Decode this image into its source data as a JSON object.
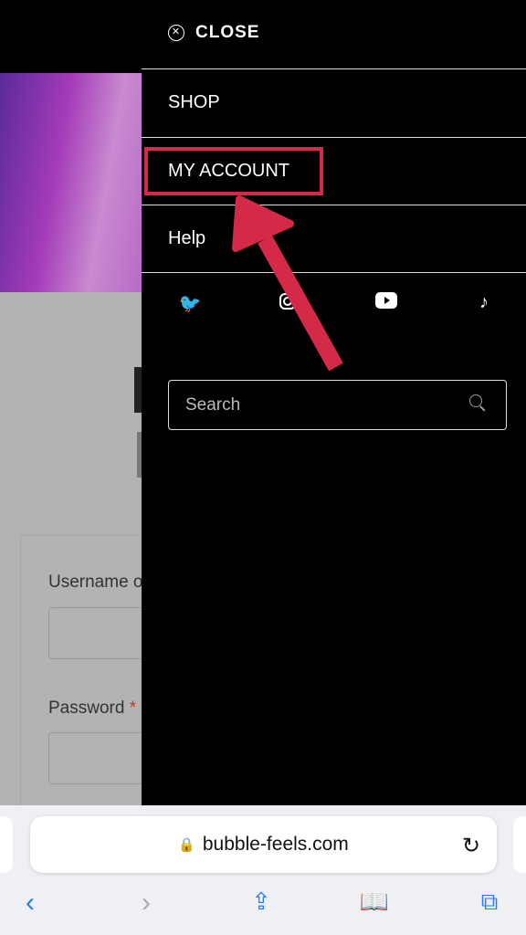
{
  "menu": {
    "close_label": "CLOSE",
    "items": [
      {
        "label": "SHOP"
      },
      {
        "label": "MY ACCOUNT"
      },
      {
        "label": "Help"
      }
    ],
    "social": [
      "twitter-icon",
      "instagram-icon",
      "youtube-icon",
      "tiktok-icon"
    ],
    "search_placeholder": "Search"
  },
  "page": {
    "username_label": "Username o",
    "password_label": "Password",
    "required_mark": "*"
  },
  "browser": {
    "url": "bubble-feels.com"
  },
  "colors": {
    "highlight": "#d42a48",
    "panel": "#000000",
    "browser_accent": "#2a7cf0"
  }
}
